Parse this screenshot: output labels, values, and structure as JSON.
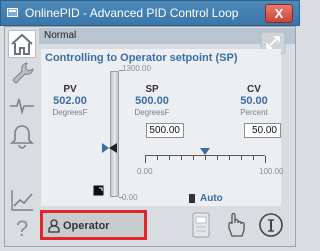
{
  "window": {
    "title": "OnlinePID - Advanced PID Control Loop",
    "close_label": "X"
  },
  "header": {
    "status": "Normal"
  },
  "panel": {
    "mode_title": "Controlling to Operator setpoint (SP)",
    "scale_max": "1300.00",
    "scale_min": "0.00",
    "pv": {
      "label": "PV",
      "value": "502.00",
      "unit": "DegreesF"
    },
    "sp": {
      "label": "SP",
      "value": "500.00",
      "unit": "DegreesF",
      "entry": "500.00"
    },
    "cv": {
      "label": "CV",
      "value": "50.00",
      "unit": "Percent",
      "entry": "50.00"
    },
    "cv_scale_min": "0.00",
    "cv_scale_max": "100.00",
    "cv_level_percent": 50,
    "pv_level_fraction": 0.386
  },
  "mode": {
    "auto_label": "Auto"
  },
  "footer": {
    "operator_label": "Operator"
  },
  "colors": {
    "accent": "#3a6ea5",
    "highlight_border": "#e0262b",
    "title_bar": "#3a76a8"
  },
  "icons": {
    "sidebar": [
      "home-icon",
      "wrench-icon",
      "trend-pulse-icon",
      "alarm-bell-icon",
      "line-chart-icon",
      "help-icon"
    ],
    "footer": [
      "faceplate-icon",
      "hand-icon",
      "info-icon"
    ]
  }
}
